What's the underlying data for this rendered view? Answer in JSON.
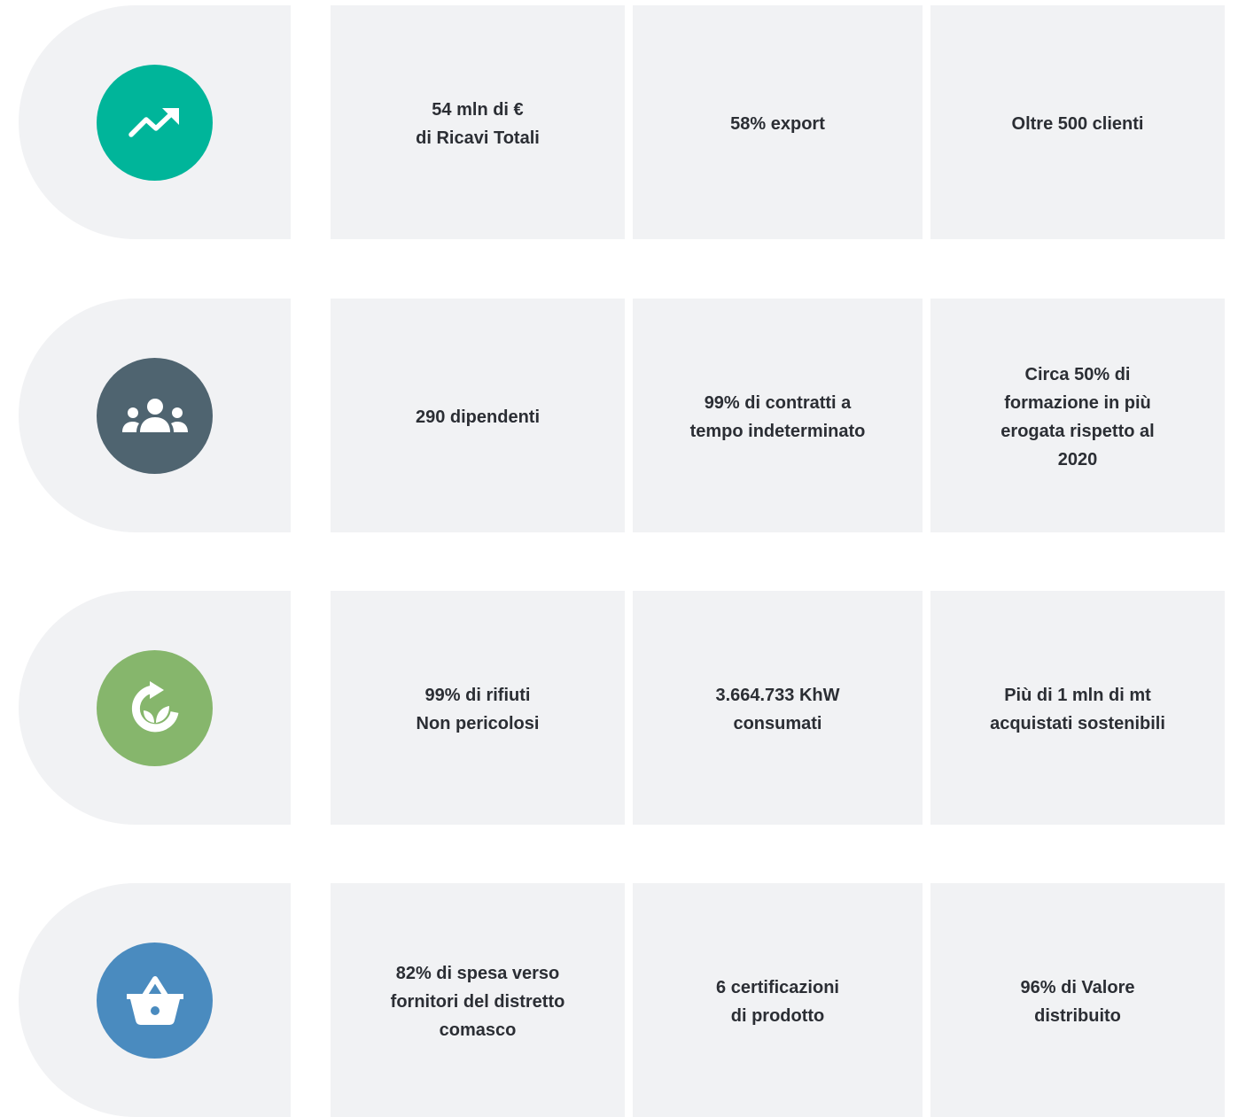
{
  "rows": [
    {
      "icon": "trending-up-icon",
      "icon_color": "#00b59a",
      "cells": [
        "54 mln di €\ndi Ricavi Totali",
        "58% export",
        "Oltre 500 clienti"
      ]
    },
    {
      "icon": "people-group-icon",
      "icon_color": "#4f6470",
      "cells": [
        "290 dipendenti",
        "99% di contratti a\ntempo indeterminato",
        "Circa 50% di\nformazione in più\nerogata rispetto al\n2020"
      ]
    },
    {
      "icon": "eco-recycle-leaf-icon",
      "icon_color": "#86b66c",
      "cells": [
        "99% di rifiuti\nNon pericolosi",
        "3.664.733 KhW\nconsumati",
        "Più di 1 mln di mt\nacquistati sostenibili"
      ]
    },
    {
      "icon": "shopping-basket-icon",
      "icon_color": "#4a8bbf",
      "cells": [
        "82% di spesa verso\nfornitori del distretto\ncomasco",
        "6 certificazioni\ndi prodotto",
        "96% di Valore\ndistribuito"
      ]
    }
  ],
  "panel_color": "#f1f2f4"
}
